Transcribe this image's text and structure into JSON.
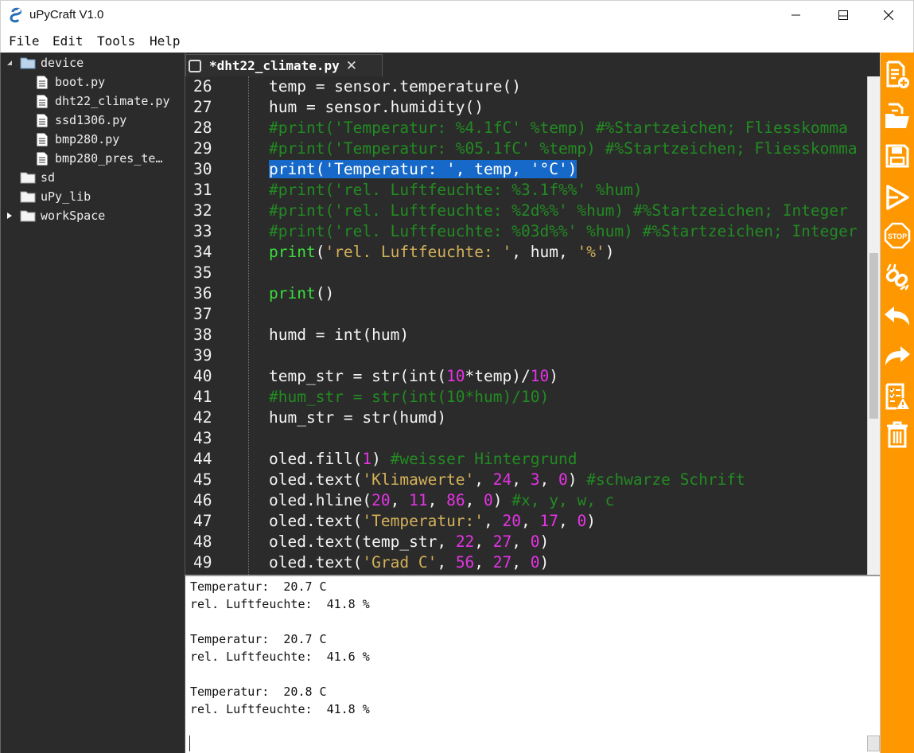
{
  "window": {
    "title": "uPyCraft V1.0",
    "controls": [
      "minimize-icon",
      "maximize-icon",
      "close-icon"
    ]
  },
  "menu": [
    "File",
    "Edit",
    "Tools",
    "Help"
  ],
  "sidebar": {
    "tree": [
      {
        "label": "device",
        "type": "folder",
        "expanded": true
      },
      {
        "label": "boot.py",
        "type": "file"
      },
      {
        "label": "dht22_climate.py",
        "type": "file"
      },
      {
        "label": "ssd1306.py",
        "type": "file"
      },
      {
        "label": "bmp280.py",
        "type": "file"
      },
      {
        "label": "bmp280_pres_te…",
        "type": "file"
      },
      {
        "label": "sd",
        "type": "folder"
      },
      {
        "label": "uPy_lib",
        "type": "folder"
      },
      {
        "label": "workSpace",
        "type": "folder",
        "expanded": false
      }
    ]
  },
  "editor": {
    "tab_label": "*dht22_climate.py",
    "lines": [
      {
        "n": "26",
        "code": [
          [
            "",
            "temp = sensor.temperature()"
          ]
        ]
      },
      {
        "n": "27",
        "code": [
          [
            "",
            "hum = sensor.humidity()"
          ]
        ]
      },
      {
        "n": "28",
        "code": [
          [
            "cm",
            "#print('Temperatur: %4.1fC' %temp) #%Startzeichen; Fliesskomma"
          ]
        ]
      },
      {
        "n": "29",
        "code": [
          [
            "cm",
            "#print('Temperatur: %05.1fC' %temp) #%Startzeichen; Fliesskomma"
          ]
        ]
      },
      {
        "n": "30",
        "code": [
          [
            "sel",
            "print('Temperatur: ', temp, '°C')"
          ]
        ]
      },
      {
        "n": "31",
        "code": [
          [
            "cm",
            "#print('rel. Luftfeuchte: %3.1f%%' %hum)"
          ]
        ]
      },
      {
        "n": "32",
        "code": [
          [
            "cm",
            "#print('rel. Luftfeuchte: %2d%%' %hum) #%Startzeichen; Integer"
          ]
        ]
      },
      {
        "n": "33",
        "code": [
          [
            "cm",
            "#print('rel. Luftfeuchte: %03d%%' %hum) #%Startzeichen; Integer"
          ]
        ]
      },
      {
        "n": "34",
        "code": [
          [
            "kw",
            "print"
          ],
          [
            "",
            "("
          ],
          [
            "str",
            "'rel. Luftfeuchte: '"
          ],
          [
            "",
            ", hum, "
          ],
          [
            "str",
            "'%'"
          ],
          [
            "",
            ")"
          ]
        ]
      },
      {
        "n": "35",
        "code": []
      },
      {
        "n": "36",
        "code": [
          [
            "kw",
            "print"
          ],
          [
            "",
            "()"
          ]
        ]
      },
      {
        "n": "37",
        "code": []
      },
      {
        "n": "38",
        "code": [
          [
            "",
            "humd = int(hum)"
          ]
        ]
      },
      {
        "n": "39",
        "code": []
      },
      {
        "n": "40",
        "code": [
          [
            "",
            "temp_str = str(int("
          ],
          [
            "num",
            "10"
          ],
          [
            "",
            "*temp)/"
          ],
          [
            "num",
            "10"
          ],
          [
            "",
            ")"
          ]
        ]
      },
      {
        "n": "41",
        "code": [
          [
            "cm",
            "#hum_str = str(int(10*hum)/10)"
          ]
        ]
      },
      {
        "n": "42",
        "code": [
          [
            "",
            "hum_str = str(humd)"
          ]
        ]
      },
      {
        "n": "43",
        "code": []
      },
      {
        "n": "44",
        "code": [
          [
            "",
            "oled.fill("
          ],
          [
            "num",
            "1"
          ],
          [
            "",
            ") "
          ],
          [
            "cm",
            "#weisser Hintergrund"
          ]
        ]
      },
      {
        "n": "45",
        "code": [
          [
            "",
            "oled.text("
          ],
          [
            "str",
            "'Klimawerte'"
          ],
          [
            "",
            ", "
          ],
          [
            "num",
            "24"
          ],
          [
            "",
            ", "
          ],
          [
            "num",
            "3"
          ],
          [
            "",
            ", "
          ],
          [
            "num",
            "0"
          ],
          [
            "",
            ") "
          ],
          [
            "cm",
            "#schwarze Schrift"
          ]
        ]
      },
      {
        "n": "46",
        "code": [
          [
            "",
            "oled.hline("
          ],
          [
            "num",
            "20"
          ],
          [
            "",
            ", "
          ],
          [
            "num",
            "11"
          ],
          [
            "",
            ", "
          ],
          [
            "num",
            "86"
          ],
          [
            "",
            ", "
          ],
          [
            "num",
            "0"
          ],
          [
            "",
            ") "
          ],
          [
            "cm",
            "#x, y, w, c"
          ]
        ]
      },
      {
        "n": "47",
        "code": [
          [
            "",
            "oled.text("
          ],
          [
            "str",
            "'Temperatur:'"
          ],
          [
            "",
            ", "
          ],
          [
            "num",
            "20"
          ],
          [
            "",
            ", "
          ],
          [
            "num",
            "17"
          ],
          [
            "",
            ", "
          ],
          [
            "num",
            "0"
          ],
          [
            "",
            ")"
          ]
        ]
      },
      {
        "n": "48",
        "code": [
          [
            "",
            "oled.text(temp_str, "
          ],
          [
            "num",
            "22"
          ],
          [
            "",
            ", "
          ],
          [
            "num",
            "27"
          ],
          [
            "",
            ", "
          ],
          [
            "num",
            "0"
          ],
          [
            "",
            ")"
          ]
        ]
      },
      {
        "n": "49",
        "code": [
          [
            "",
            "oled.text("
          ],
          [
            "str",
            "'Grad C'"
          ],
          [
            "",
            ", "
          ],
          [
            "num",
            "56"
          ],
          [
            "",
            ", "
          ],
          [
            "num",
            "27"
          ],
          [
            "",
            ", "
          ],
          [
            "num",
            "0"
          ],
          [
            "",
            ")"
          ]
        ]
      }
    ]
  },
  "console": {
    "lines": [
      "Temperatur:  20.7 C",
      "rel. Luftfeuchte:  41.8 %",
      "",
      "Temperatur:  20.7 C",
      "rel. Luftfeuchte:  41.6 %",
      "",
      "Temperatur:  20.8 C",
      "rel. Luftfeuchte:  41.8 %"
    ]
  },
  "toolbar": {
    "tools": [
      "new-file-icon",
      "open-file-icon",
      "save-icon",
      "download-run-icon",
      "stop-icon",
      "connect-icon",
      "undo-icon",
      "redo-icon",
      "syntax-check-icon",
      "clear-icon"
    ],
    "stop_label": "STOP",
    "accent": "#ff9800"
  },
  "colors": {
    "editor_bg": "#2b2b2b",
    "comment": "#228b22",
    "string": "#d4b15a",
    "number": "#e633e6",
    "keyword": "#3cdc3c",
    "selection": "#1669c9"
  }
}
